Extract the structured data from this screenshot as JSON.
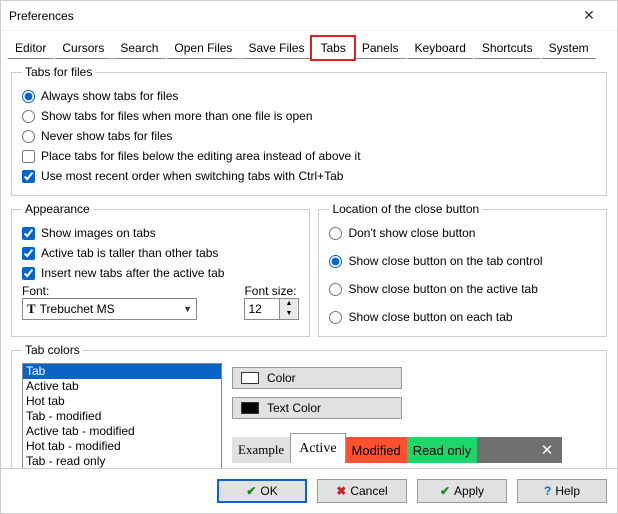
{
  "title": "Preferences",
  "tabs": [
    "Editor",
    "Cursors",
    "Search",
    "Open Files",
    "Save Files",
    "Tabs",
    "Panels",
    "Keyboard",
    "Shortcuts",
    "System"
  ],
  "active_tab": "Tabs",
  "groups": {
    "tabs_for_files": {
      "legend": "Tabs for files",
      "opts": [
        "Always show tabs for files",
        "Show tabs for files when more than one file is open",
        "Never show tabs for files",
        "Place tabs for files below the editing area instead of above it",
        "Use most recent order when switching tabs with Ctrl+Tab"
      ],
      "selected_radio": 0,
      "checks": {
        "below": false,
        "mru": true
      }
    },
    "appearance": {
      "legend": "Appearance",
      "opts": [
        "Show images on tabs",
        "Active tab is taller than other tabs",
        "Insert new tabs after the active tab"
      ],
      "checks": [
        true,
        true,
        true
      ],
      "font_label": "Font:",
      "font_value": "Trebuchet MS",
      "font_size_label": "Font size:",
      "font_size_value": "12"
    },
    "close_button": {
      "legend": "Location of the close button",
      "opts": [
        "Don't show close button",
        "Show close button on the tab control",
        "Show close button on the active tab",
        "Show close button on each tab"
      ],
      "selected_radio": 1
    },
    "tab_colors": {
      "legend": "Tab colors",
      "items": [
        "Tab",
        "Active tab",
        "Hot tab",
        "Tab - modified",
        "Active tab - modified",
        "Hot tab - modified",
        "Tab - read only"
      ],
      "selected_item": 0,
      "color_label": "Color",
      "color_value": "#ffffff",
      "text_color_label": "Text Color",
      "text_color_value": "#000000",
      "examples": [
        "Example",
        "Active",
        "Modified",
        "Read only"
      ],
      "example_colors": {
        "example": "#e0e0e0",
        "active": "#ffffff",
        "modified": "#ff5030",
        "readonly": "#1cd66a"
      }
    }
  },
  "buttons": {
    "ok": "OK",
    "cancel": "Cancel",
    "apply": "Apply",
    "help": "Help"
  }
}
